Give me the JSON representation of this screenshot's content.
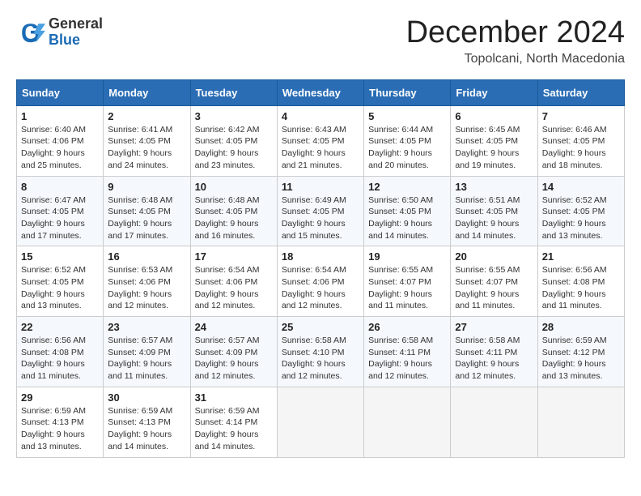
{
  "header": {
    "logo_general": "General",
    "logo_blue": "Blue",
    "month_title": "December 2024",
    "location": "Topolcani, North Macedonia"
  },
  "calendar": {
    "days_of_week": [
      "Sunday",
      "Monday",
      "Tuesday",
      "Wednesday",
      "Thursday",
      "Friday",
      "Saturday"
    ],
    "weeks": [
      [
        {
          "day": "1",
          "sunrise": "6:40 AM",
          "sunset": "4:06 PM",
          "daylight": "9 hours and 25 minutes."
        },
        {
          "day": "2",
          "sunrise": "6:41 AM",
          "sunset": "4:05 PM",
          "daylight": "9 hours and 24 minutes."
        },
        {
          "day": "3",
          "sunrise": "6:42 AM",
          "sunset": "4:05 PM",
          "daylight": "9 hours and 23 minutes."
        },
        {
          "day": "4",
          "sunrise": "6:43 AM",
          "sunset": "4:05 PM",
          "daylight": "9 hours and 21 minutes."
        },
        {
          "day": "5",
          "sunrise": "6:44 AM",
          "sunset": "4:05 PM",
          "daylight": "9 hours and 20 minutes."
        },
        {
          "day": "6",
          "sunrise": "6:45 AM",
          "sunset": "4:05 PM",
          "daylight": "9 hours and 19 minutes."
        },
        {
          "day": "7",
          "sunrise": "6:46 AM",
          "sunset": "4:05 PM",
          "daylight": "9 hours and 18 minutes."
        }
      ],
      [
        {
          "day": "8",
          "sunrise": "6:47 AM",
          "sunset": "4:05 PM",
          "daylight": "9 hours and 17 minutes."
        },
        {
          "day": "9",
          "sunrise": "6:48 AM",
          "sunset": "4:05 PM",
          "daylight": "9 hours and 17 minutes."
        },
        {
          "day": "10",
          "sunrise": "6:48 AM",
          "sunset": "4:05 PM",
          "daylight": "9 hours and 16 minutes."
        },
        {
          "day": "11",
          "sunrise": "6:49 AM",
          "sunset": "4:05 PM",
          "daylight": "9 hours and 15 minutes."
        },
        {
          "day": "12",
          "sunrise": "6:50 AM",
          "sunset": "4:05 PM",
          "daylight": "9 hours and 14 minutes."
        },
        {
          "day": "13",
          "sunrise": "6:51 AM",
          "sunset": "4:05 PM",
          "daylight": "9 hours and 14 minutes."
        },
        {
          "day": "14",
          "sunrise": "6:52 AM",
          "sunset": "4:05 PM",
          "daylight": "9 hours and 13 minutes."
        }
      ],
      [
        {
          "day": "15",
          "sunrise": "6:52 AM",
          "sunset": "4:05 PM",
          "daylight": "9 hours and 13 minutes."
        },
        {
          "day": "16",
          "sunrise": "6:53 AM",
          "sunset": "4:06 PM",
          "daylight": "9 hours and 12 minutes."
        },
        {
          "day": "17",
          "sunrise": "6:54 AM",
          "sunset": "4:06 PM",
          "daylight": "9 hours and 12 minutes."
        },
        {
          "day": "18",
          "sunrise": "6:54 AM",
          "sunset": "4:06 PM",
          "daylight": "9 hours and 12 minutes."
        },
        {
          "day": "19",
          "sunrise": "6:55 AM",
          "sunset": "4:07 PM",
          "daylight": "9 hours and 11 minutes."
        },
        {
          "day": "20",
          "sunrise": "6:55 AM",
          "sunset": "4:07 PM",
          "daylight": "9 hours and 11 minutes."
        },
        {
          "day": "21",
          "sunrise": "6:56 AM",
          "sunset": "4:08 PM",
          "daylight": "9 hours and 11 minutes."
        }
      ],
      [
        {
          "day": "22",
          "sunrise": "6:56 AM",
          "sunset": "4:08 PM",
          "daylight": "9 hours and 11 minutes."
        },
        {
          "day": "23",
          "sunrise": "6:57 AM",
          "sunset": "4:09 PM",
          "daylight": "9 hours and 11 minutes."
        },
        {
          "day": "24",
          "sunrise": "6:57 AM",
          "sunset": "4:09 PM",
          "daylight": "9 hours and 12 minutes."
        },
        {
          "day": "25",
          "sunrise": "6:58 AM",
          "sunset": "4:10 PM",
          "daylight": "9 hours and 12 minutes."
        },
        {
          "day": "26",
          "sunrise": "6:58 AM",
          "sunset": "4:11 PM",
          "daylight": "9 hours and 12 minutes."
        },
        {
          "day": "27",
          "sunrise": "6:58 AM",
          "sunset": "4:11 PM",
          "daylight": "9 hours and 12 minutes."
        },
        {
          "day": "28",
          "sunrise": "6:59 AM",
          "sunset": "4:12 PM",
          "daylight": "9 hours and 13 minutes."
        }
      ],
      [
        {
          "day": "29",
          "sunrise": "6:59 AM",
          "sunset": "4:13 PM",
          "daylight": "9 hours and 13 minutes."
        },
        {
          "day": "30",
          "sunrise": "6:59 AM",
          "sunset": "4:13 PM",
          "daylight": "9 hours and 14 minutes."
        },
        {
          "day": "31",
          "sunrise": "6:59 AM",
          "sunset": "4:14 PM",
          "daylight": "9 hours and 14 minutes."
        },
        null,
        null,
        null,
        null
      ]
    ]
  }
}
